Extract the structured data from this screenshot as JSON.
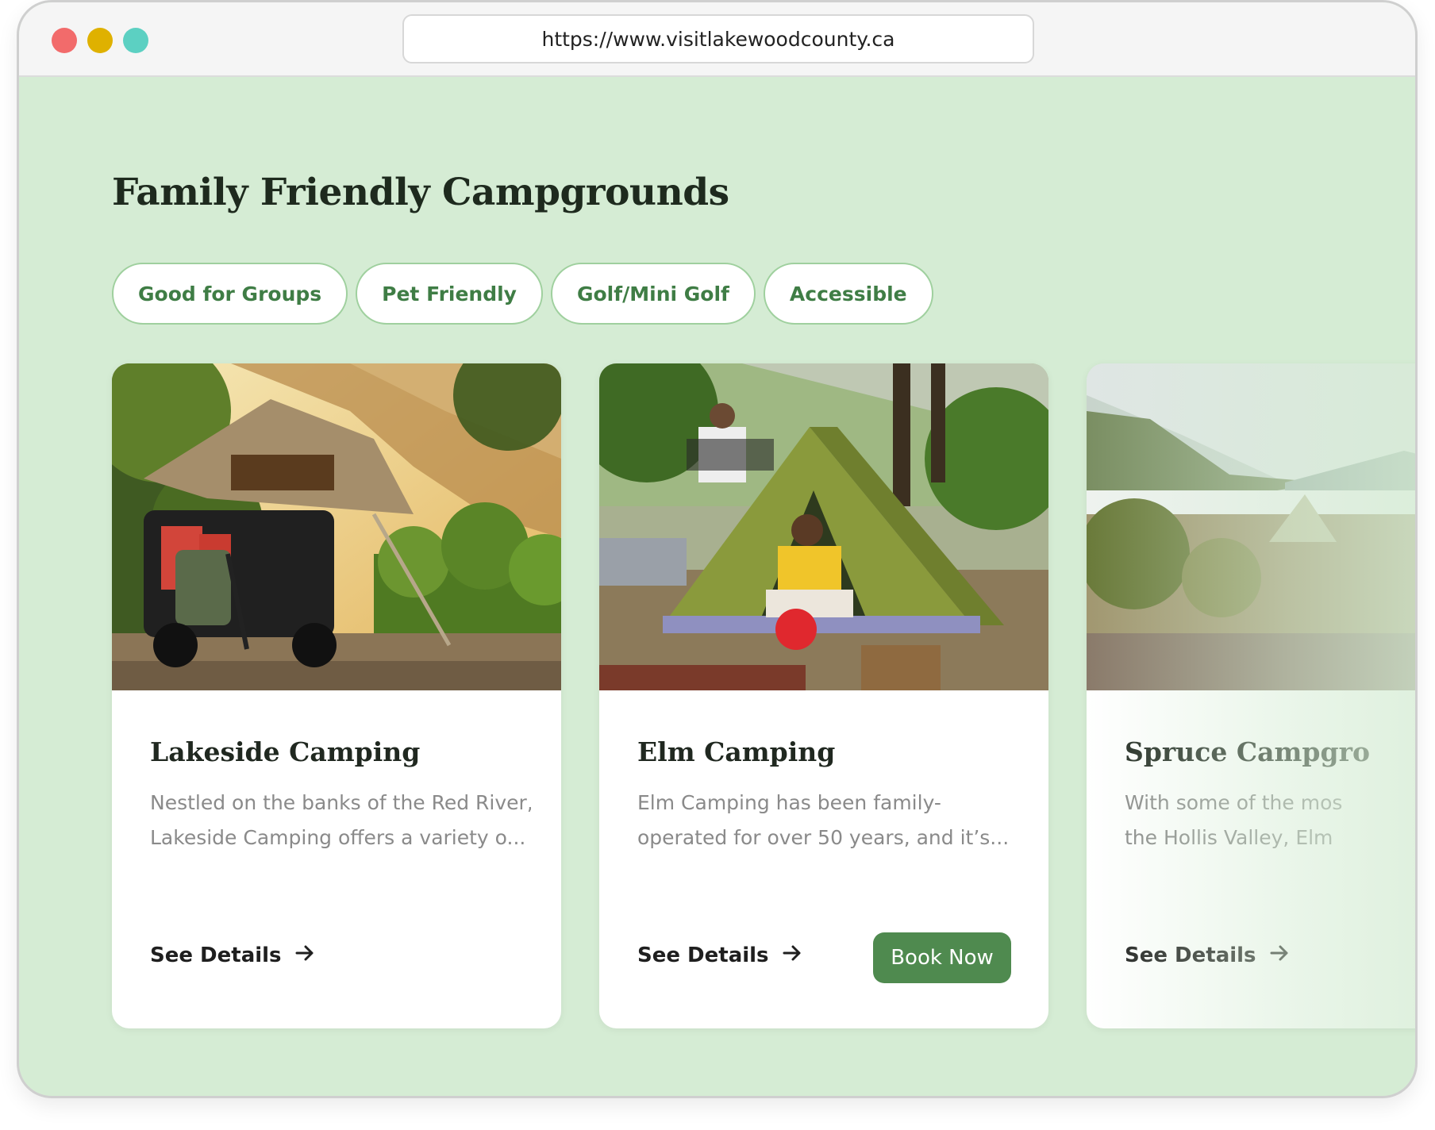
{
  "browser": {
    "url": "https://www.visitlakewoodcounty.ca"
  },
  "page": {
    "title": "Family Friendly Campgrounds"
  },
  "filters": [
    {
      "label": "Good for Groups"
    },
    {
      "label": "Pet Friendly"
    },
    {
      "label": "Golf/Mini Golf"
    },
    {
      "label": "Accessible"
    }
  ],
  "cards": [
    {
      "title": "Lakeside Camping",
      "desc_lines": [
        "Nestled on the banks of the Red River,",
        "Lakeside Camping offers a variety o..."
      ],
      "details_label": "See Details"
    },
    {
      "title": "Elm Camping",
      "desc_lines": [
        "Elm Camping has been family-",
        "operated for over 50 years, and it’s..."
      ],
      "details_label": "See Details",
      "book_label": "Book Now"
    },
    {
      "title": "Spruce Campgro",
      "desc_lines": [
        "With some of the mos",
        "the Hollis Valley, Elm"
      ],
      "details_label": "See Details"
    }
  ],
  "colors": {
    "page_background": "#d5ecd4",
    "accent_green": "#4f8a4f",
    "chip_text": "#3f7d45",
    "chip_border": "#9fd09e"
  }
}
